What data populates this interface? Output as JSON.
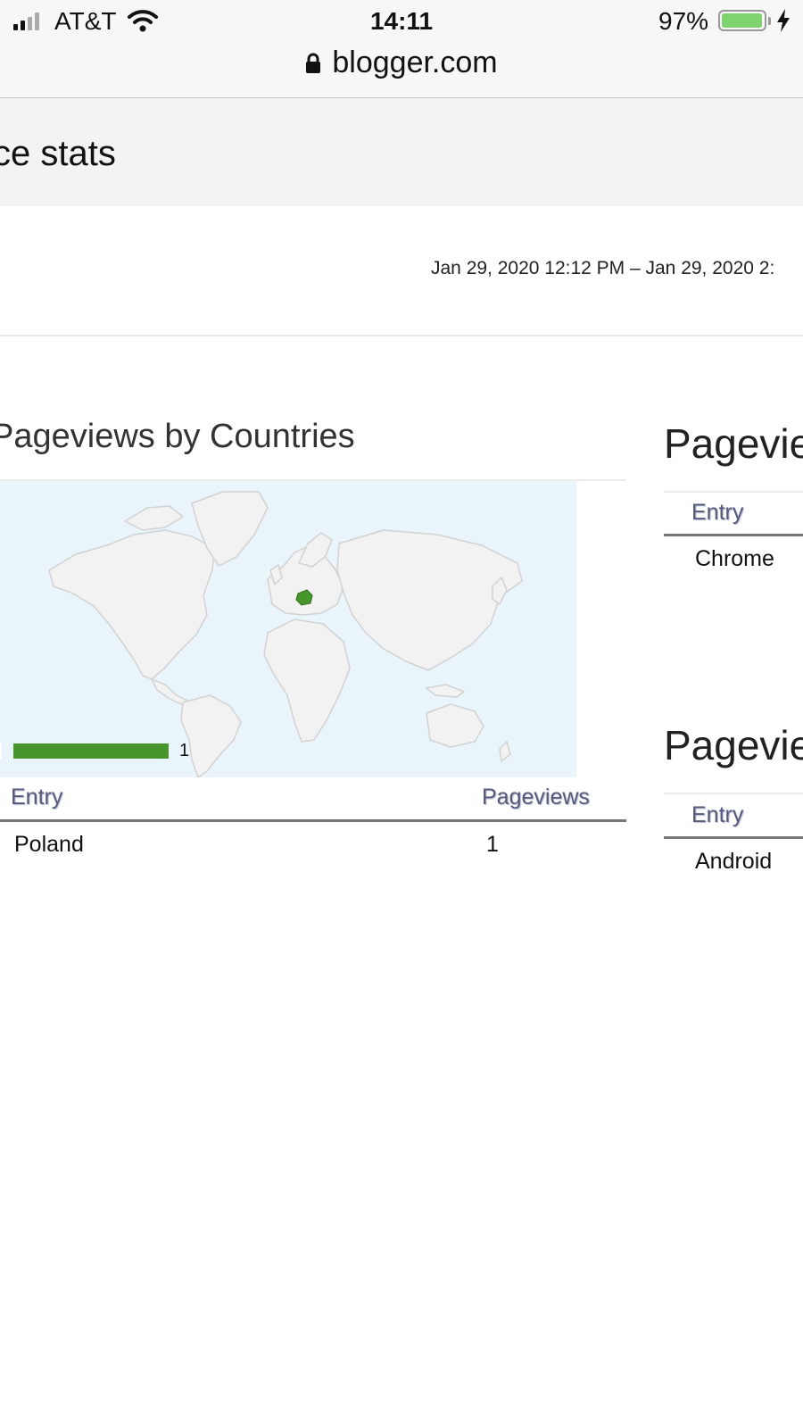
{
  "status_bar": {
    "carrier": "AT&T",
    "time": "14:11",
    "battery_percent": "97%",
    "battery_level": 0.97
  },
  "address_bar": {
    "url": "blogger.com"
  },
  "page": {
    "title": "ce stats",
    "date_range": "Jan 29, 2020 12:12 PM – Jan 29, 2020 2:"
  },
  "countries_panel": {
    "title": "Pageviews by Countries",
    "legend_value": "1",
    "highlight_color": "#46962b",
    "table": {
      "headers": [
        "Entry",
        "Pageviews"
      ],
      "rows": [
        {
          "entry": "Poland",
          "pageviews": "1"
        }
      ]
    }
  },
  "browsers_panel": {
    "title": "Pagevie",
    "header": "Entry",
    "rows": [
      "Chrome"
    ]
  },
  "os_panel": {
    "title": "Pagevie",
    "header": "Entry",
    "rows": [
      "Android"
    ]
  }
}
